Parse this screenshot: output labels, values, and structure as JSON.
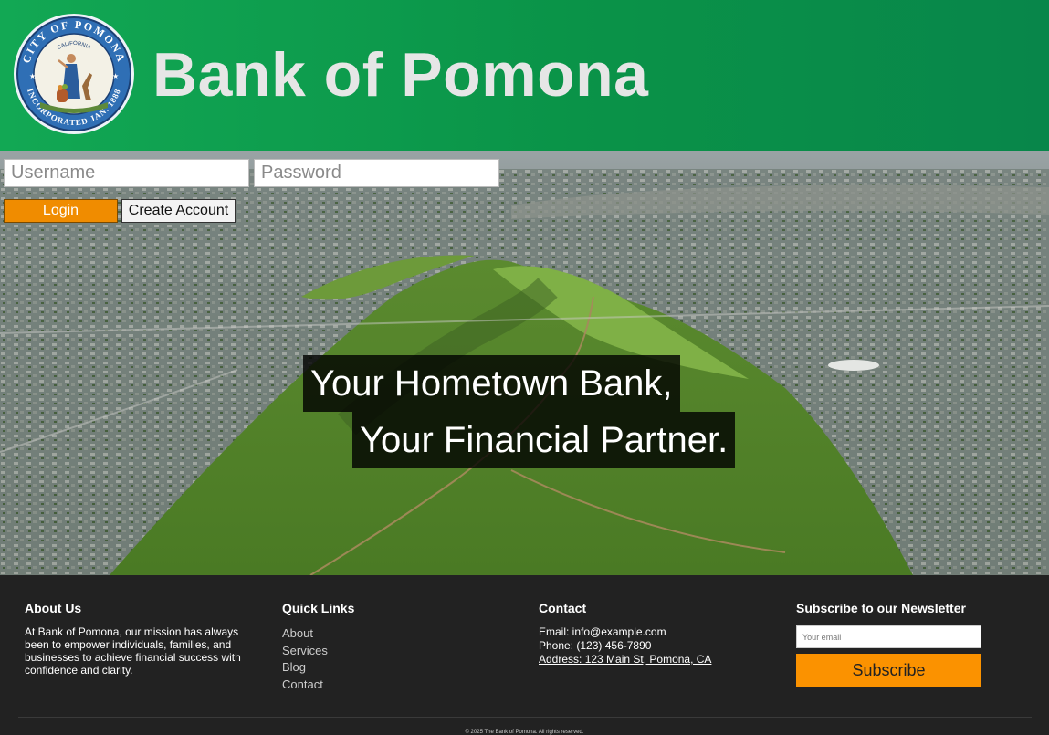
{
  "header": {
    "title": "Bank of Pomona",
    "seal": {
      "top_text": "CITY OF POMONA",
      "state": "CALIFORNIA",
      "bottom_text": "INCORPORATED JAN. 1888",
      "icon": "city-seal"
    }
  },
  "login": {
    "username_placeholder": "Username",
    "password_placeholder": "Password",
    "login_label": "Login",
    "create_label": "Create Account"
  },
  "hero": {
    "line1": "Your Hometown Bank,",
    "line2": "Your Financial Partner."
  },
  "footer": {
    "about": {
      "heading": "About Us",
      "text": "At Bank of Pomona, our mission has always been to empower individuals, families, and businesses to achieve financial success with confidence and clarity."
    },
    "quick_links": {
      "heading": "Quick Links",
      "items": [
        "About",
        "Services",
        "Blog",
        "Contact"
      ]
    },
    "contact": {
      "heading": "Contact",
      "email": "Email: info@example.com",
      "phone": "Phone: (123) 456-7890",
      "address": "Address: 123 Main St, Pomona, CA"
    },
    "newsletter": {
      "heading": "Subscribe to our Newsletter",
      "email_placeholder": "Your email",
      "button_label": "Subscribe"
    },
    "copyright": "© 2025 The Bank of Pomona. All rights reserved."
  },
  "colors": {
    "header_green": "#0a9348",
    "login_orange": "#f08c00",
    "subscribe_orange": "#fb9200",
    "footer_bg": "#222222"
  }
}
